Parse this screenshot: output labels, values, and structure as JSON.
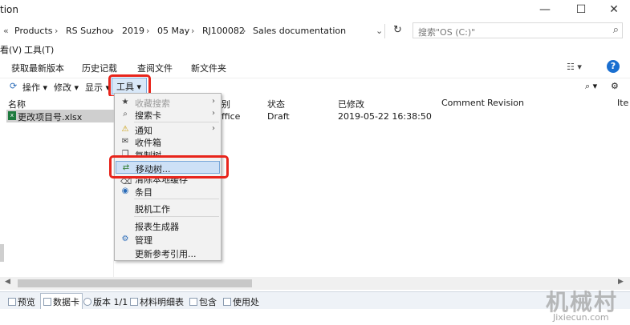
{
  "window": {
    "title": "tion",
    "minimize_glyph": "—",
    "maximize_glyph": "☐",
    "close_glyph": "✕"
  },
  "address": {
    "prefix": "«",
    "crumbs": [
      "Products",
      "RS Suzhou",
      "2019",
      "05 May",
      "RJ100082",
      "Sales documentation"
    ],
    "separator": "›",
    "dropdown_glyph": "⌄",
    "refresh_glyph": "↻",
    "search_placeholder": "搜索\"OS (C:)\"",
    "search_icon": "search-icon"
  },
  "menubar": {
    "items": [
      "看(V)",
      "工具(T)"
    ]
  },
  "commandbar": {
    "items": [
      "获取最新版本",
      "历史记载",
      "查阅文件",
      "新文件夹"
    ],
    "view_glyph": "☷ ▾",
    "help_label": "?"
  },
  "toolbar": {
    "items": [
      "操作 ▾",
      "修改 ▾",
      "显示 ▾"
    ],
    "tools_label": "工具 ▾",
    "right_glyphs": [
      "⌕ ▾",
      "⚙"
    ]
  },
  "columns": {
    "name": "名称",
    "category_fragment": "别",
    "state": "状态",
    "checked_in": "已修改",
    "comment": "Comment",
    "revision": "Revision",
    "item_fragment": "Ite"
  },
  "file_row": {
    "icon_label": "x",
    "name": "更改项目号.xlsx",
    "category_fragment": "ffice",
    "state": "Draft",
    "modified": "2019-05-22 16:38:50"
  },
  "context_menu": {
    "items": [
      {
        "label": "收藏搜索",
        "icon": "star-icon",
        "glyph": "★",
        "disabled": true,
        "submenu": true
      },
      {
        "label": "搜索卡",
        "icon": "search-icon",
        "glyph": "⌕",
        "disabled": false,
        "submenu": true
      },
      {
        "label": "通知",
        "icon": "warning-icon",
        "glyph": "⚠",
        "disabled": false,
        "submenu": true
      },
      {
        "label": "收件箱",
        "icon": "inbox-icon",
        "glyph": "✉",
        "disabled": false,
        "submenu": false
      },
      {
        "label": "复制树",
        "icon": "copy-tree-icon",
        "glyph": "❐",
        "disabled": false,
        "submenu": false
      },
      {
        "label": "移动树...",
        "icon": "move-tree-icon",
        "glyph": "⇄",
        "disabled": false,
        "submenu": false,
        "selected": true
      },
      {
        "label": "清除本地缓存",
        "icon": "clear-cache-icon",
        "glyph": "⌫",
        "disabled": false,
        "submenu": false
      },
      {
        "label": "条目",
        "icon": "item-icon",
        "glyph": "◉",
        "disabled": false,
        "submenu": false
      },
      {
        "label": "脱机工作",
        "icon": "",
        "glyph": "",
        "disabled": false,
        "submenu": false
      },
      {
        "label": "报表生成器",
        "icon": "",
        "glyph": "",
        "disabled": false,
        "submenu": false
      },
      {
        "label": "管理",
        "icon": "admin-icon",
        "glyph": "⚙",
        "disabled": false,
        "submenu": false
      },
      {
        "label": "更新参考引用...",
        "icon": "",
        "glyph": "",
        "disabled": false,
        "submenu": false
      }
    ],
    "submenu_glyph": "›"
  },
  "scrollbar": {
    "left_glyph": "◀",
    "right_glyph": "▶"
  },
  "bottom_tabs": [
    "预览",
    "数据卡",
    "版本 1/1",
    "材料明细表",
    "包含",
    "使用处"
  ],
  "watermark": {
    "text": "机械村",
    "url": "Jixiecun.com"
  },
  "colors": {
    "highlight": "#e8251c",
    "selection": "#cde0f6",
    "accent": "#1a6fd0"
  }
}
